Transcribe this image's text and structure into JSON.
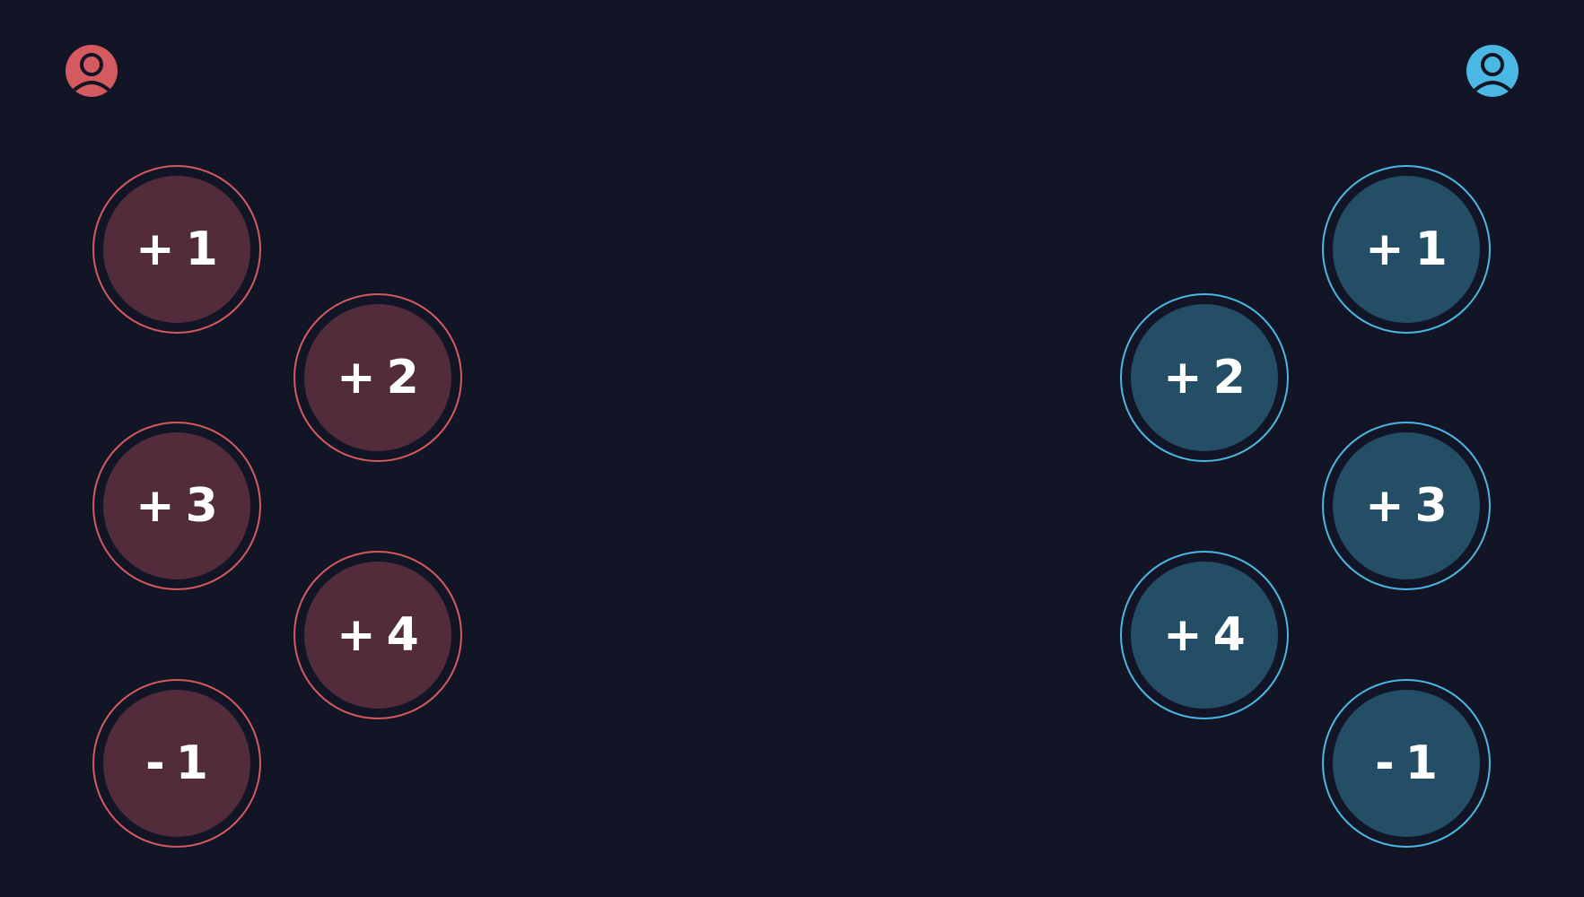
{
  "players": {
    "red": {
      "color": "#d45a5f",
      "icon": "user-icon",
      "buttons": [
        "+1",
        "+2",
        "+3",
        "+4",
        "-1"
      ]
    },
    "blue": {
      "color": "#4ab8e2",
      "icon": "user-icon",
      "buttons": [
        "+1",
        "+2",
        "+3",
        "+4",
        "-1"
      ]
    }
  },
  "background": "#121526"
}
